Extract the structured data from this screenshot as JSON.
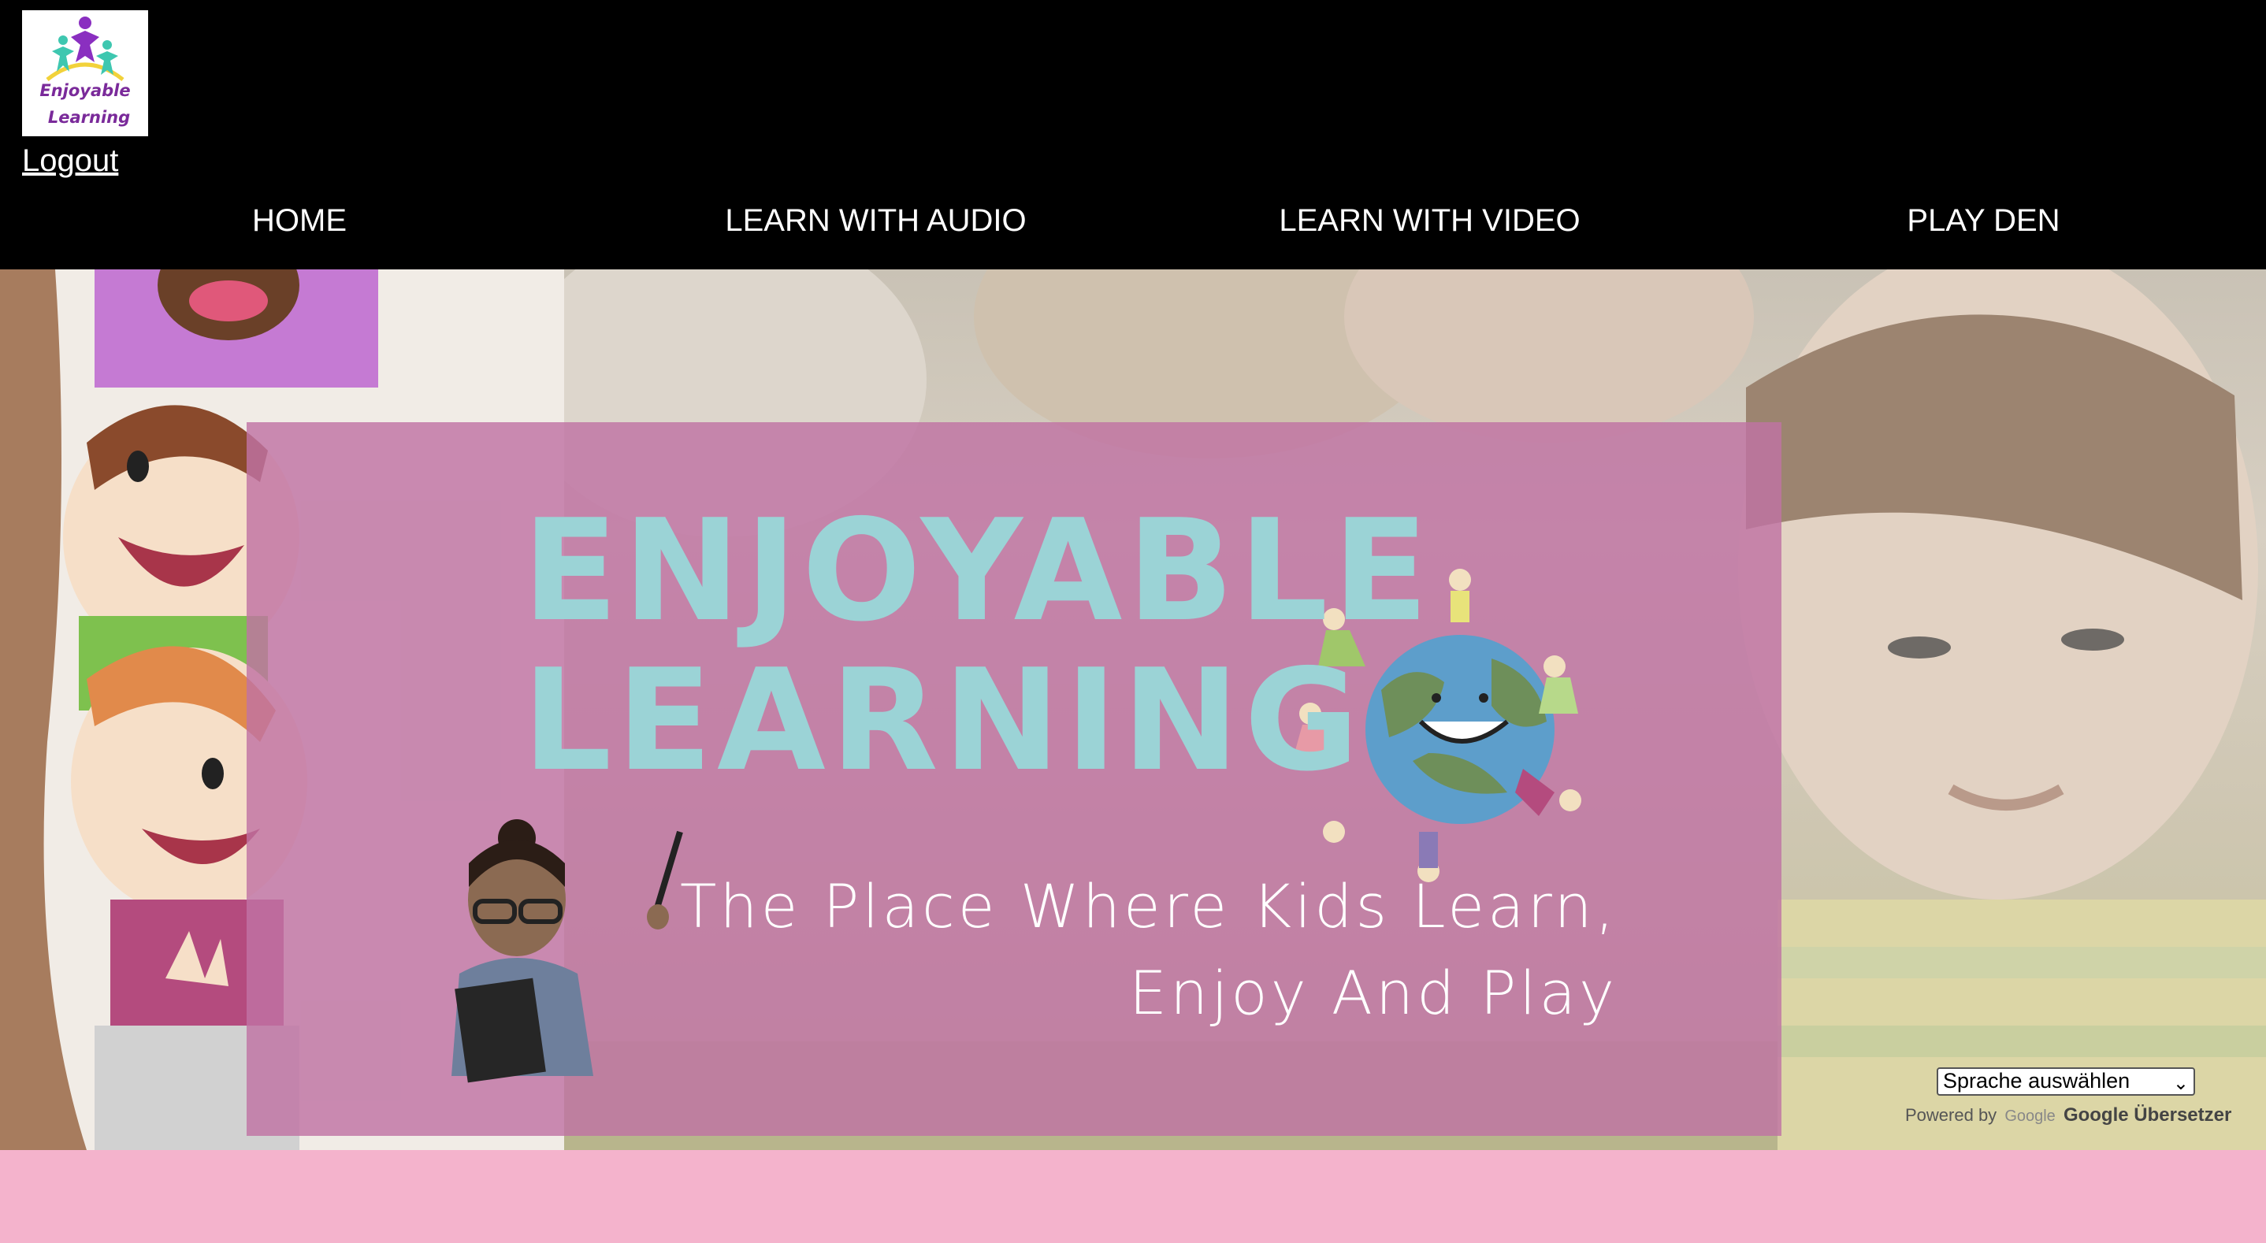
{
  "logo": {
    "line1": "Enjoyable",
    "line2": "Learning"
  },
  "header": {
    "logout_label": "Logout"
  },
  "nav": {
    "items": [
      {
        "label": "HOME"
      },
      {
        "label": "LEARN WITH AUDIO"
      },
      {
        "label": "LEARN WITH VIDEO"
      },
      {
        "label": "PLAY DEN"
      }
    ]
  },
  "hero": {
    "title_line1": "ENJOYABLE",
    "title_line2": "LEARNING",
    "tagline_line1": "The Place Where Kids Learn,",
    "tagline_line2": "Enjoy And Play"
  },
  "translate": {
    "select_value": "Sprache auswählen",
    "powered_by": "Powered by",
    "google_word": "Google",
    "service_name": "Google Übersetzer"
  },
  "colors": {
    "header_bg": "#000000",
    "banner_pink": "#bf73a3",
    "title_teal": "#9bd3d6",
    "footer_pink": "#f4b3cc",
    "logo_purple": "#7a2a9a"
  },
  "icons": [
    "logo-figures-icon",
    "chevron-down-icon",
    "google-logo-icon"
  ]
}
